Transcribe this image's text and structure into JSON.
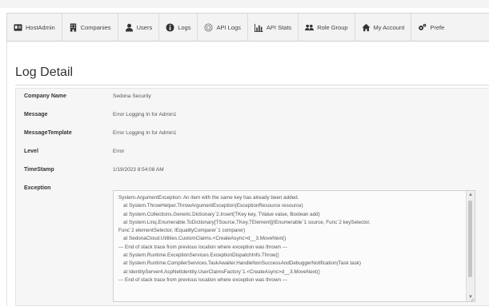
{
  "nav": {
    "items": [
      {
        "label": "HostAdmin",
        "icon": "id-card-icon"
      },
      {
        "label": "Companies",
        "icon": "building-icon"
      },
      {
        "label": "Users",
        "icon": "user-icon"
      },
      {
        "label": "Logs",
        "icon": "info-icon"
      },
      {
        "label": "API Logs",
        "icon": "api-icon"
      },
      {
        "label": "API Stats",
        "icon": "bar-chart-icon"
      },
      {
        "label": "Role Group",
        "icon": "users-icon"
      },
      {
        "label": "My Account",
        "icon": "home-icon"
      },
      {
        "label": "Prefe",
        "icon": "cogs-icon"
      }
    ]
  },
  "page": {
    "title": "Log Detail"
  },
  "details": {
    "company_name": {
      "label": "Company Name",
      "value": "Sedona Security"
    },
    "message": {
      "label": "Message",
      "value": "Error Logging In for Admin1"
    },
    "message_template": {
      "label": "MessageTemplate",
      "value": "Error Logging In for Admin1"
    },
    "level": {
      "label": "Level",
      "value": "Error"
    },
    "timestamp": {
      "label": "TimeStamp",
      "value": "1/19/2023 8:54:08 AM"
    },
    "exception": {
      "label": "Exception",
      "lines": [
        "System.ArgumentException: An item with the same key has already been added.",
        "   at System.ThrowHelper.ThrowArgumentException(ExceptionResource resource)",
        "   at System.Collections.Generic.Dictionary`2.Insert(TKey key, TValue value, Boolean add)",
        "   at System.Linq.Enumerable.ToDictionary[TSource,TKey,TElement](IEnumerable`1 source, Func`2 keySelector,",
        "Func`2 elementSelector, IEqualityComparer`1 comparer)",
        "   at SedonaCloud.Utilities.CustomClaims.<CreateAsync>d__3.MoveNext()",
        "--- End of stack trace from previous location where exception was thrown ---",
        "   at System.Runtime.ExceptionServices.ExceptionDispatchInfo.Throw()",
        "   at System.Runtime.CompilerServices.TaskAwaiter.HandleNonSuccessAndDebuggerNotification(Task task)",
        "   at IdentityServer4.AspNetIdentity.UserClaimsFactory`1.<CreateAsync>d__3.MoveNext()",
        "--- End of stack trace from previous location where exception was thrown ---"
      ]
    }
  }
}
